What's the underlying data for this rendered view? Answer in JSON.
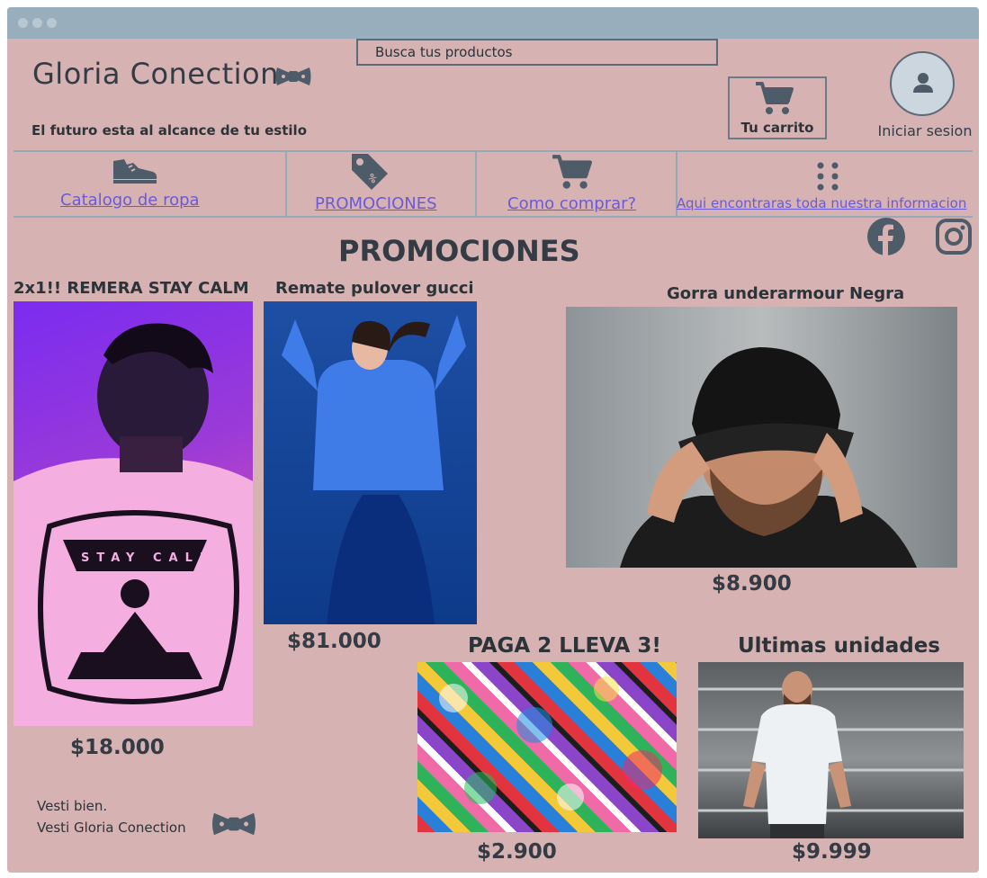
{
  "window": {
    "title_dots": [
      "dot-1",
      "dot-2",
      "dot-3"
    ]
  },
  "header": {
    "brand": "Gloria Conection",
    "tagline": "El futuro esta al alcance de tu estilo",
    "search_placeholder": "Busca tus productos",
    "cart_label": "Tu carrito",
    "login_label": "Iniciar sesion"
  },
  "nav": {
    "items": [
      {
        "label": "Catalogo de ropa",
        "icon": "shoe-icon"
      },
      {
        "label": "PROMOCIONES",
        "icon": "price-tag-icon"
      },
      {
        "label": "Como comprar?",
        "icon": "cart-icon"
      },
      {
        "label": "Aqui  encontraras toda nuestra informacion",
        "icon": "dots-grid-icon"
      }
    ]
  },
  "social": {
    "facebook": "facebook-icon",
    "instagram": "instagram-icon"
  },
  "main": {
    "title": "PROMOCIONES",
    "products": [
      {
        "title": "2x1!! REMERA STAY CALM",
        "price": "$18.000",
        "image": "shirt-photo",
        "print_text": "STAY CALM"
      },
      {
        "title": "Remate pulover gucci",
        "price": "$81.000",
        "image": "sweater-photo"
      },
      {
        "title": "Gorra underarmour Negra",
        "price": "$8.900",
        "image": "cap-photo"
      },
      {
        "title": "PAGA 2 LLEVA 3!",
        "price": "$2.900",
        "image": "socks-photo"
      },
      {
        "title": "Ultimas unidades",
        "price": "$9.999",
        "image": "tshirt-photo"
      }
    ]
  },
  "footer": {
    "line1": "Vesti bien.",
    "line2": "Vesti Gloria Conection"
  },
  "colors": {
    "background": "#d6b2b2",
    "titlebar": "#99aebd",
    "link": "#6a5ad8",
    "text": "#333c45"
  }
}
